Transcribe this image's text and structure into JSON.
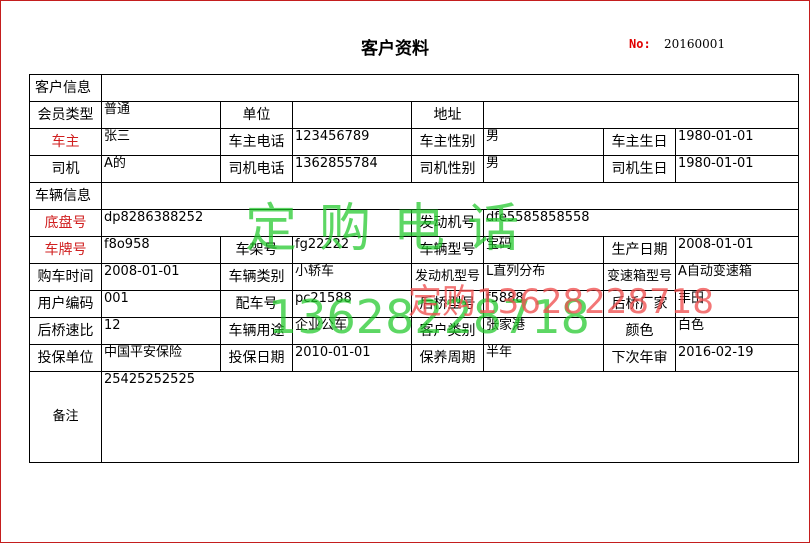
{
  "title": "客户资料",
  "doc_no": {
    "label": "No:",
    "value": "20160001"
  },
  "sections": {
    "customer": "客户信息",
    "vehicle": "车辆信息"
  },
  "customer": {
    "member_type": {
      "label": "会员类型",
      "value": "普通"
    },
    "company": {
      "label": "单位",
      "value": ""
    },
    "address": {
      "label": "地址",
      "value": ""
    },
    "owner": {
      "label": "车主",
      "value": "张三"
    },
    "owner_phone": {
      "label": "车主电话",
      "value": "123456789"
    },
    "owner_gender": {
      "label": "车主性别",
      "value": "男"
    },
    "owner_birthday": {
      "label": "车主生日",
      "value": "1980-01-01"
    },
    "driver": {
      "label": "司机",
      "value": "A的"
    },
    "driver_phone": {
      "label": "司机电话",
      "value": "1362855784"
    },
    "driver_gender": {
      "label": "司机性别",
      "value": "男"
    },
    "driver_birthday": {
      "label": "司机生日",
      "value": "1980-01-01"
    }
  },
  "vehicle": {
    "chassis_no": {
      "label": "底盘号",
      "value": "dp8286388252"
    },
    "engine_no": {
      "label": "发动机号",
      "value": "dfe5585858558"
    },
    "plate_no": {
      "label": "车牌号",
      "value": "f8o958"
    },
    "frame_no": {
      "label": "车架号",
      "value": "fg22222"
    },
    "model": {
      "label": "车辆型号",
      "value": "宝码"
    },
    "production_date": {
      "label": "生产日期",
      "value": "2008-01-01"
    },
    "purchase_date": {
      "label": "购车时间",
      "value": "2008-01-01"
    },
    "vehicle_class": {
      "label": "车辆类别",
      "value": "小轿车"
    },
    "engine_model": {
      "label": "发动机型号",
      "value": "L直列分布"
    },
    "gearbox_model": {
      "label": "变速箱型号",
      "value": "A自动变速箱"
    },
    "user_code": {
      "label": "用户编码",
      "value": "001"
    },
    "key_no": {
      "label": "配车号",
      "value": "pc21588"
    },
    "rear_axle_model": {
      "label": "后桥型号",
      "value": "f5888"
    },
    "rear_axle_maker": {
      "label": "后桥厂家",
      "value": "丰田"
    },
    "rear_axle_ratio": {
      "label": "后桥速比",
      "value": "12"
    },
    "usage": {
      "label": "车辆用途",
      "value": "企业公车"
    },
    "customer_type": {
      "label": "客户类别",
      "value": "张家港"
    },
    "color": {
      "label": "颜色",
      "value": "白色"
    },
    "insurer": {
      "label": "投保单位",
      "value": "中国平安保险"
    },
    "insure_date": {
      "label": "投保日期",
      "value": "2010-01-01"
    },
    "maintenance_cycle": {
      "label": "保养周期",
      "value": "半年"
    },
    "next_inspection": {
      "label": "下次年审",
      "value": "2016-02-19"
    }
  },
  "remarks": {
    "label": "备注",
    "value": "25425252525"
  },
  "watermarks": {
    "line1": "定购电话",
    "line2": "13628228718",
    "line3": "定购13628228718"
  },
  "colors": {
    "label_red": "#d02020",
    "watermark_green": "#1ec828",
    "watermark_red": "#f05050"
  }
}
